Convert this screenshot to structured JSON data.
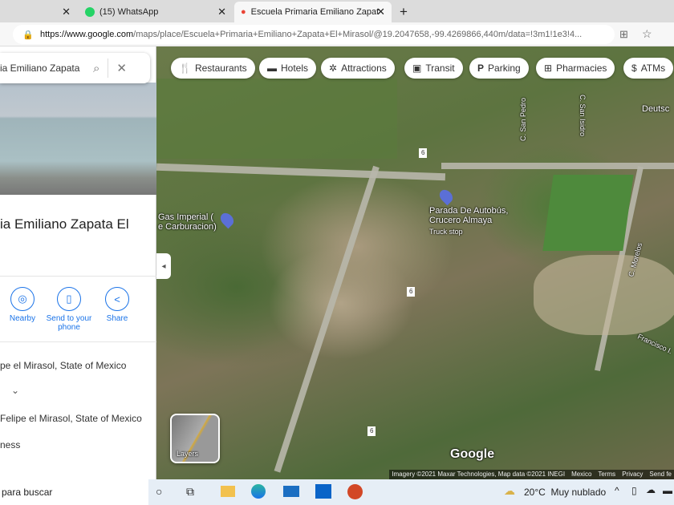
{
  "tabs": [
    {
      "title": "(15) WhatsApp"
    },
    {
      "title": "Escuela Primaria Emiliano Zapat"
    }
  ],
  "new_tab": "+",
  "url_host": "https://www.google.com",
  "url_path": "/maps/place/Escuela+Primaria+Emiliano+Zapata+El+Mirasol/@19.2047658,-99.4269866,440m/data=!3m1!1e3!4...",
  "search": {
    "value": "ia Emiliano Zapata"
  },
  "place": {
    "title": "ia Emiliano Zapata El"
  },
  "actions": [
    {
      "label": "Nearby",
      "icon": "◎"
    },
    {
      "label": "Send to your phone",
      "icon": "▯"
    },
    {
      "label": "Share",
      "icon": "<"
    }
  ],
  "rows": [
    "pe el Mirasol, State of Mexico",
    "Felipe el Mirasol, State of Mexico",
    "ness"
  ],
  "chips": [
    {
      "label": "Restaurants",
      "icon": "🍴"
    },
    {
      "label": "Hotels",
      "icon": "▬"
    },
    {
      "label": "Attractions",
      "icon": "✲"
    },
    {
      "label": "Transit",
      "icon": "▣"
    },
    {
      "label": "Parking",
      "icon": "P"
    },
    {
      "label": "Pharmacies",
      "icon": "⊞"
    },
    {
      "label": "ATMs",
      "icon": "$"
    }
  ],
  "map_labels": {
    "gas": "Gas Imperial (\ne Carburacion)",
    "bus": "Parada De Autobús,\nCrucero Almaya",
    "bus_sub": "Truck stop",
    "san_pedro": "C. San Pedro",
    "san_isidro": "C. San Isidro",
    "deutsch": "Deutsc",
    "morelos": "C. Morelos",
    "francisco": "Francisco I.",
    "route": "6",
    "layers": "Layers",
    "google": "Google"
  },
  "attribution": [
    "Imagery ©2021 Maxar Technologies, Map data ©2021 INEGI",
    "Mexico",
    "Terms",
    "Privacy",
    "Send fe"
  ],
  "taskbar": {
    "search": "para buscar",
    "weather": "20°C  Muy nublado"
  }
}
